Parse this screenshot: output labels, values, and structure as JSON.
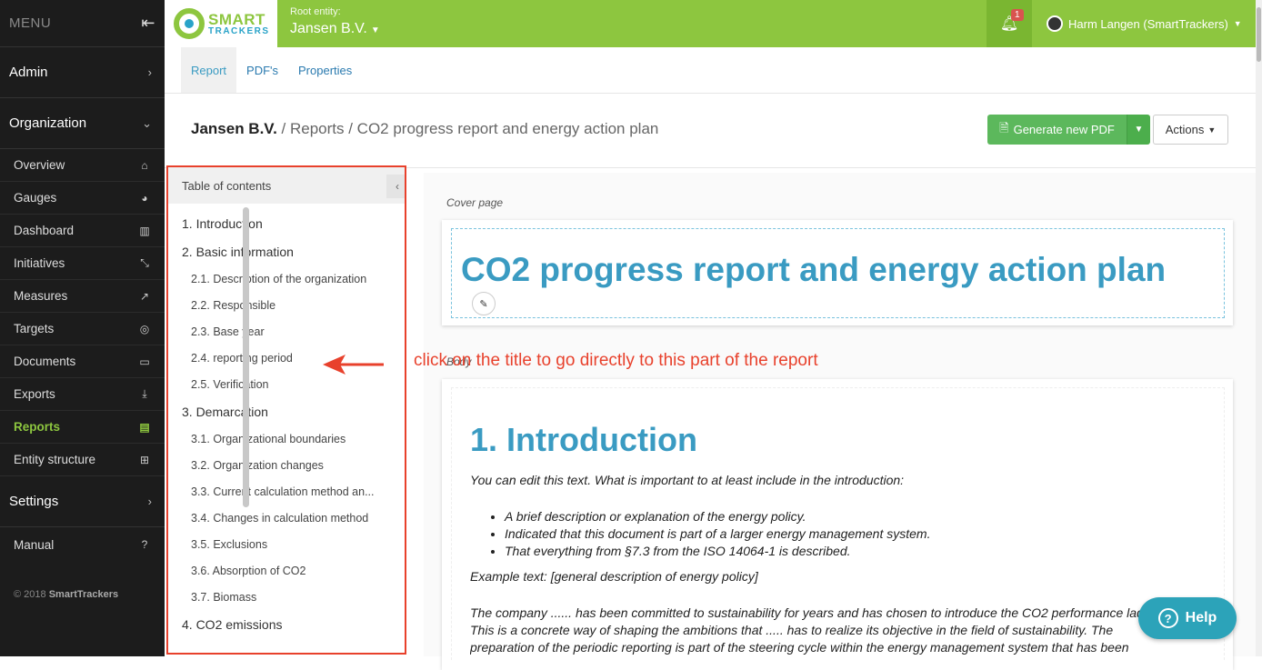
{
  "sidebar": {
    "menu_label": "MENU",
    "admin": "Admin",
    "organization": "Organization",
    "items": [
      {
        "label": "Overview",
        "icon": "home-icon",
        "glyph": "⌂"
      },
      {
        "label": "Gauges",
        "icon": "gauge-icon",
        "glyph": "◕"
      },
      {
        "label": "Dashboard",
        "icon": "bar-chart-icon",
        "glyph": "▥"
      },
      {
        "label": "Initiatives",
        "icon": "compress-icon",
        "glyph": "⤡"
      },
      {
        "label": "Measures",
        "icon": "line-chart-icon",
        "glyph": "↗"
      },
      {
        "label": "Targets",
        "icon": "target-icon",
        "glyph": "◎"
      },
      {
        "label": "Documents",
        "icon": "folder-open-icon",
        "glyph": "▭"
      },
      {
        "label": "Exports",
        "icon": "download-icon",
        "glyph": "⤓"
      },
      {
        "label": "Reports",
        "icon": "file-text-icon",
        "glyph": "▤"
      },
      {
        "label": "Entity structure",
        "icon": "sitemap-icon",
        "glyph": "⊞"
      }
    ],
    "settings": "Settings",
    "manual": "Manual",
    "copyright_prefix": "© 2018",
    "copyright_brand": "SmartTrackers"
  },
  "topbar": {
    "logo_line1": "SMART",
    "logo_line2": "TRACKERS",
    "root_label": "Root entity:",
    "root_value": "Jansen B.V.",
    "notification_count": "1",
    "user_name": "Harm Langen (SmartTrackers)"
  },
  "tabs": [
    "Report",
    "PDF's",
    "Properties"
  ],
  "breadcrumb": {
    "entity": "Jansen B.V.",
    "path": " / Reports / CO2 progress report and energy action plan"
  },
  "buttons": {
    "generate": "Generate new PDF",
    "actions": "Actions"
  },
  "toc": {
    "header": "Table of contents",
    "entries": [
      {
        "level": 1,
        "text": "1. Introduction"
      },
      {
        "level": 1,
        "text": "2. Basic information"
      },
      {
        "level": 2,
        "text": "2.1. Description of the organization"
      },
      {
        "level": 2,
        "text": "2.2. Responsible"
      },
      {
        "level": 2,
        "text": "2.3. Base year"
      },
      {
        "level": 2,
        "text": "2.4. reporting period"
      },
      {
        "level": 2,
        "text": "2.5. Verification"
      },
      {
        "level": 1,
        "text": "3. Demarcation"
      },
      {
        "level": 2,
        "text": "3.1. Organizational boundaries"
      },
      {
        "level": 2,
        "text": "3.2. Organization changes"
      },
      {
        "level": 2,
        "text": "3.3. Current calculation method an..."
      },
      {
        "level": 2,
        "text": "3.4. Changes in calculation method"
      },
      {
        "level": 2,
        "text": "3.5. Exclusions"
      },
      {
        "level": 2,
        "text": "3.6. Absorption of CO2"
      },
      {
        "level": 2,
        "text": "3.7. Biomass"
      },
      {
        "level": 1,
        "text": "4. CO2 emissions"
      }
    ]
  },
  "annotation": "click on the title to go directly to this part of the report",
  "report": {
    "cover_label": "Cover page",
    "cover_title": "CO2 progress report and energy action plan",
    "body_label": "Body",
    "heading": "1. Introduction",
    "intro": "You can edit this text. What is important to at least include in the introduction:",
    "bullets": [
      "A brief description or explanation of the energy policy.",
      "Indicated that this document is part of a larger energy management system.",
      "That everything from §7.3 from the ISO 14064-1 is described."
    ],
    "example": "Example text: [general description of energy policy]",
    "paragraph": [
      "The company ...... has been committed to sustainability for years and has chosen to introduce the CO2 performance ladder.",
      "This is a concrete way of shaping the ambitions that ..... has to realize its objective in the field of sustainability. The",
      "preparation of the periodic reporting is part of the steering cycle within the energy management system that has been"
    ]
  },
  "help": "Help",
  "colors": {
    "brand_green": "#8dc63f",
    "accent_blue": "#3a9bc2",
    "annotation_red": "#e8412c"
  }
}
